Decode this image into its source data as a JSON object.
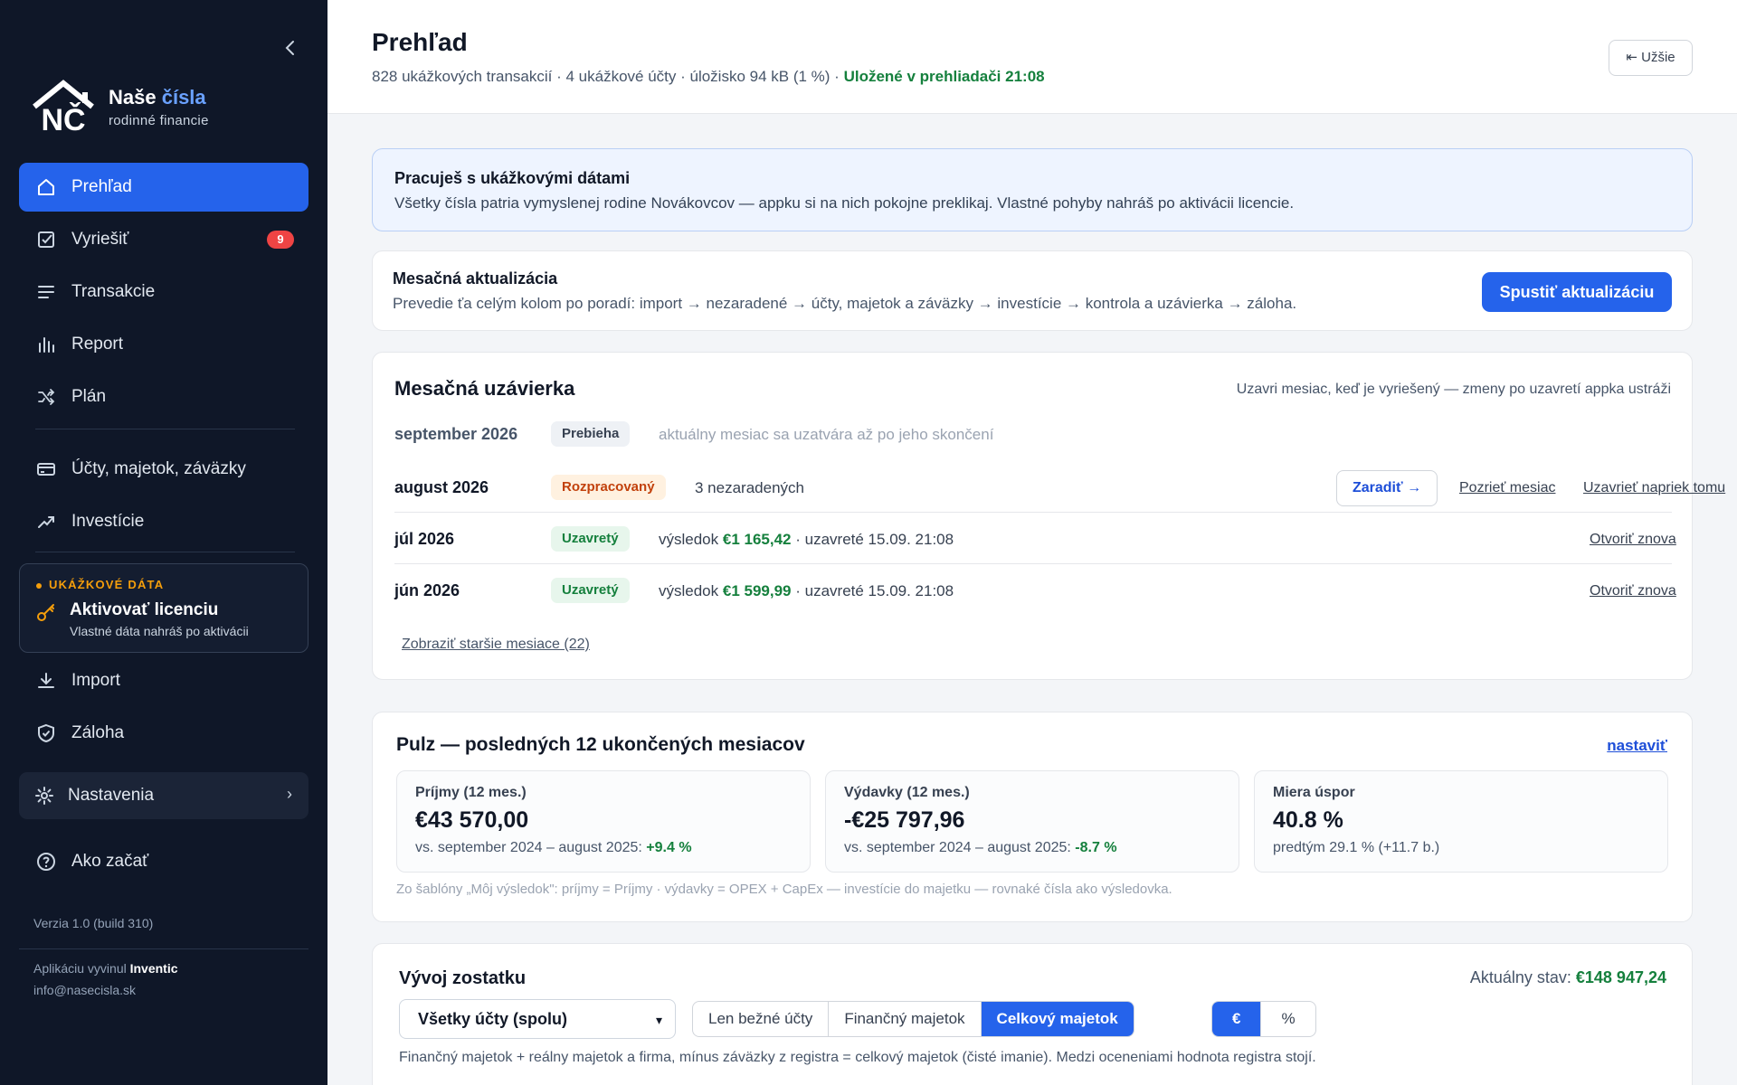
{
  "sidebar": {
    "brand": {
      "name_part1": "Naše",
      "name_part2": "čísla",
      "subtitle": "rodinné financie",
      "logo_letters": "NČ"
    },
    "items": [
      {
        "label": "Prehľad",
        "icon": "home-icon",
        "active": true
      },
      {
        "label": "Vyriešiť",
        "icon": "checkbox-icon",
        "badge": "9"
      },
      {
        "label": "Transakcie",
        "icon": "list-icon"
      },
      {
        "label": "Report",
        "icon": "bar-chart-icon"
      },
      {
        "label": "Plán",
        "icon": "shuffle-icon"
      },
      {
        "label": "Účty, majetok, záväzky",
        "icon": "credit-card-icon"
      },
      {
        "label": "Investície",
        "icon": "trend-up-icon"
      },
      {
        "label": "Import",
        "icon": "download-icon"
      },
      {
        "label": "Záloha",
        "icon": "shield-icon"
      },
      {
        "label": "Ako začať",
        "icon": "help-icon"
      }
    ],
    "license": {
      "tag": "UKÁŽKOVÉ DÁTA",
      "title": "Aktivovať licenciu",
      "subtitle": "Vlastné dáta nahráš po aktivácii"
    },
    "settings": {
      "label": "Nastavenia"
    },
    "version": "Verzia 1.0 (build 310)",
    "developer_prefix": "Aplikáciu vyvinul",
    "developer_name": "Inventic",
    "email": "info@nasecisla.sk"
  },
  "header": {
    "title": "Prehľad",
    "meta": "828 ukážkových transakcií · 4 ukážkové účty · úložisko 94 kB (1 %) ·",
    "saved": "Uložené v prehliadači 21:08",
    "narrow_button": "⇤ Užšie"
  },
  "info_banner": {
    "title": "Pracuješ s ukážkovými dátami",
    "text": "Všetky čísla patria vymyslenej rodine Novákovcov — appku si na nich pokojne preklikaj. Vlastné pohyby nahráš po aktivácii licencie."
  },
  "monthly_update": {
    "title": "Mesačná aktualizácia",
    "text": "Prevedie ťa celým kolom po poradí: import → nezaradené → účty, majetok a záväzky → investície → kontrola a uzávierka → záloha.",
    "button": "Spustiť aktualizáciu"
  },
  "monthly_close": {
    "title": "Mesačná uzávierka",
    "hint": "Uzavri mesiac, keď je vyriešený — zmeny po uzavretí appka ustráži",
    "rows": [
      {
        "month": "september 2026",
        "status": "Prebieha",
        "desc": "aktuálny mesiac sa uzatvára až po jeho skončení"
      },
      {
        "month": "august 2026",
        "status": "Rozpracovaný",
        "desc": "3 nezaradených",
        "assign": "Zaradiť →",
        "view": "Pozrieť mesiac",
        "force_close": "Uzavrieť napriek tomu"
      },
      {
        "month": "júl 2026",
        "status": "Uzavretý",
        "desc_prefix": "výsledok",
        "value": "€1 165,42",
        "desc_suffix": "· uzavreté 15.09. 21:08",
        "reopen": "Otvoriť znova"
      },
      {
        "month": "jún 2026",
        "status": "Uzavretý",
        "desc_prefix": "výsledok",
        "value": "€1 599,99",
        "desc_suffix": "· uzavreté 15.09. 21:08",
        "reopen": "Otvoriť znova"
      }
    ],
    "older_link": "Zobraziť staršie mesiace (22)"
  },
  "pulse": {
    "title": "Pulz — posledných 12 ukončených mesiacov",
    "settings_link": "nastaviť",
    "kpis": [
      {
        "label": "Príjmy (12 mes.)",
        "value": "€43 570,00",
        "compare": "vs. september 2024 – august 2025:",
        "change": "+9.4 %"
      },
      {
        "label": "Výdavky (12 mes.)",
        "value": "-€25 797,96",
        "compare": "vs. september 2024 – august 2025:",
        "change": "-8.7 %"
      },
      {
        "label": "Miera úspor",
        "value": "40.8 %",
        "compare": "predtým 29.1 % (+11.7 b.)"
      }
    ],
    "note": "Zo šablóny „Môj výsledok\": príjmy = Príjmy · výdavky = OPEX + CapEx — investície do majetku — rovnaké čísla ako výsledovka."
  },
  "balance": {
    "title": "Vývoj zostatku",
    "state_label": "Aktuálny stav:",
    "state_value": "€148 947,24",
    "account_select": "Všetky účty (spolu)",
    "scope_options": [
      "Len bežné účty",
      "Finančný majetok",
      "Celkový majetok"
    ],
    "scope_selected": "Celkový majetok",
    "unit_options": [
      "€",
      "%"
    ],
    "unit_selected": "€",
    "note": "Finančný majetok + reálny majetok a firma, mínus záväzky z registra = celkový majetok (čisté imanie). Medzi oceneniami hodnota registra stojí."
  },
  "colors": {
    "accent": "#2563eb",
    "sidebar_bg": "#0f1728",
    "positive": "#15803d",
    "warning": "#c2410c",
    "badge": "#ef4444"
  }
}
